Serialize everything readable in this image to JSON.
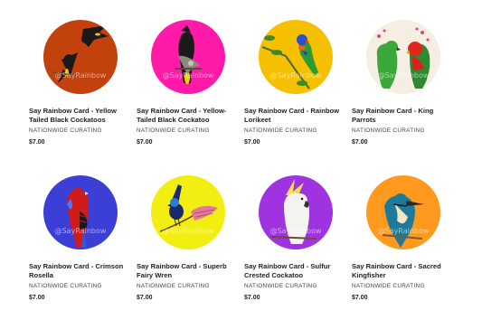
{
  "products": [
    {
      "title": "Say Rainbow Card - Yellow Tailed Black Cockatoos",
      "vendor": "NATIONWIDE CURATING",
      "price": "$7.00",
      "watermark": "@SayRainbow",
      "bg": "#c2410c",
      "bird": "black-cockatoo-pair-icon"
    },
    {
      "title": "Say Rainbow Card - Yellow-Tailed Black Cockatoo",
      "vendor": "NATIONWIDE CURATING",
      "price": "$7.00",
      "watermark": "@SayRainbow",
      "bg": "#ff1aa8",
      "bird": "black-cockatoo-icon"
    },
    {
      "title": "Say Rainbow Card - Rainbow Lorikeet",
      "vendor": "NATIONWIDE CURATING",
      "price": "$7.00",
      "watermark": "@SayRainbow",
      "bg": "#f5c000",
      "bird": "rainbow-lorikeet-icon"
    },
    {
      "title": "Say Rainbow Card - King Parrots",
      "vendor": "NATIONWIDE CURATING",
      "price": "$7.00",
      "watermark": "@SayRainbow",
      "bg": "#f6ede3",
      "bird": "king-parrots-icon"
    },
    {
      "title": "Say Rainbow Card - Crimson Rosella",
      "vendor": "NATIONWIDE CURATING",
      "price": "$7.00",
      "watermark": "@SayRainbow",
      "bg": "#3b3fd6",
      "bird": "crimson-rosella-icon"
    },
    {
      "title": "Say Rainbow Card - Superb Fairy Wren",
      "vendor": "NATIONWIDE CURATING",
      "price": "$7.00",
      "watermark": "@SayRainbow",
      "bg": "#f2ee12",
      "bird": "fairy-wren-icon"
    },
    {
      "title": "Say Rainbow Card - Sulfur Crested Cockatoo",
      "vendor": "NATIONWIDE CURATING",
      "price": "$7.00",
      "watermark": "@SayRainbow",
      "bg": "#a033e0",
      "bird": "sulfur-cockatoo-icon"
    },
    {
      "title": "Say Rainbow Card - Sacred Kingfisher",
      "vendor": "NATIONWIDE CURATING",
      "price": "$7.00",
      "watermark": "@SayRainbow",
      "bg": "#ff9a1f",
      "bird": "kingfisher-icon"
    }
  ]
}
